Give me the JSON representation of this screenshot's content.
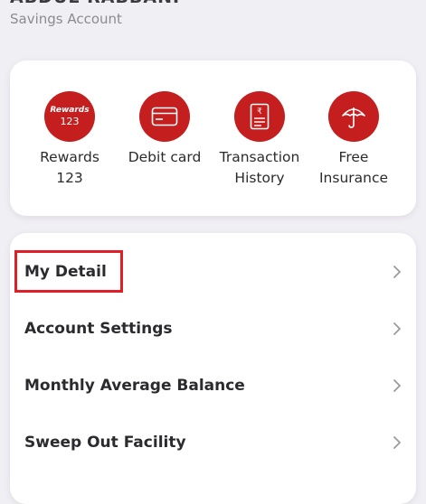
{
  "header": {
    "account_name": "ABDUL RABBANI",
    "account_type": "Savings Account"
  },
  "quick_actions": [
    {
      "label": "Rewards 123",
      "icon": "rewards-123-icon",
      "icon_text_top": "Rewards",
      "icon_text_bottom": "123"
    },
    {
      "label": "Debit card",
      "icon": "debit-card-icon"
    },
    {
      "label": "Transaction History",
      "icon": "transaction-history-icon"
    },
    {
      "label": "Free Insurance",
      "icon": "umbrella-icon"
    }
  ],
  "menu": {
    "items": [
      {
        "label": "My Detail",
        "highlighted": true
      },
      {
        "label": "Account Settings"
      },
      {
        "label": "Monthly Average Balance"
      },
      {
        "label": "Sweep Out Facility"
      }
    ]
  },
  "colors": {
    "accent": "#c41e1e",
    "highlight_border": "#e01e27",
    "background": "#f0eff4",
    "card": "#ffffff"
  }
}
